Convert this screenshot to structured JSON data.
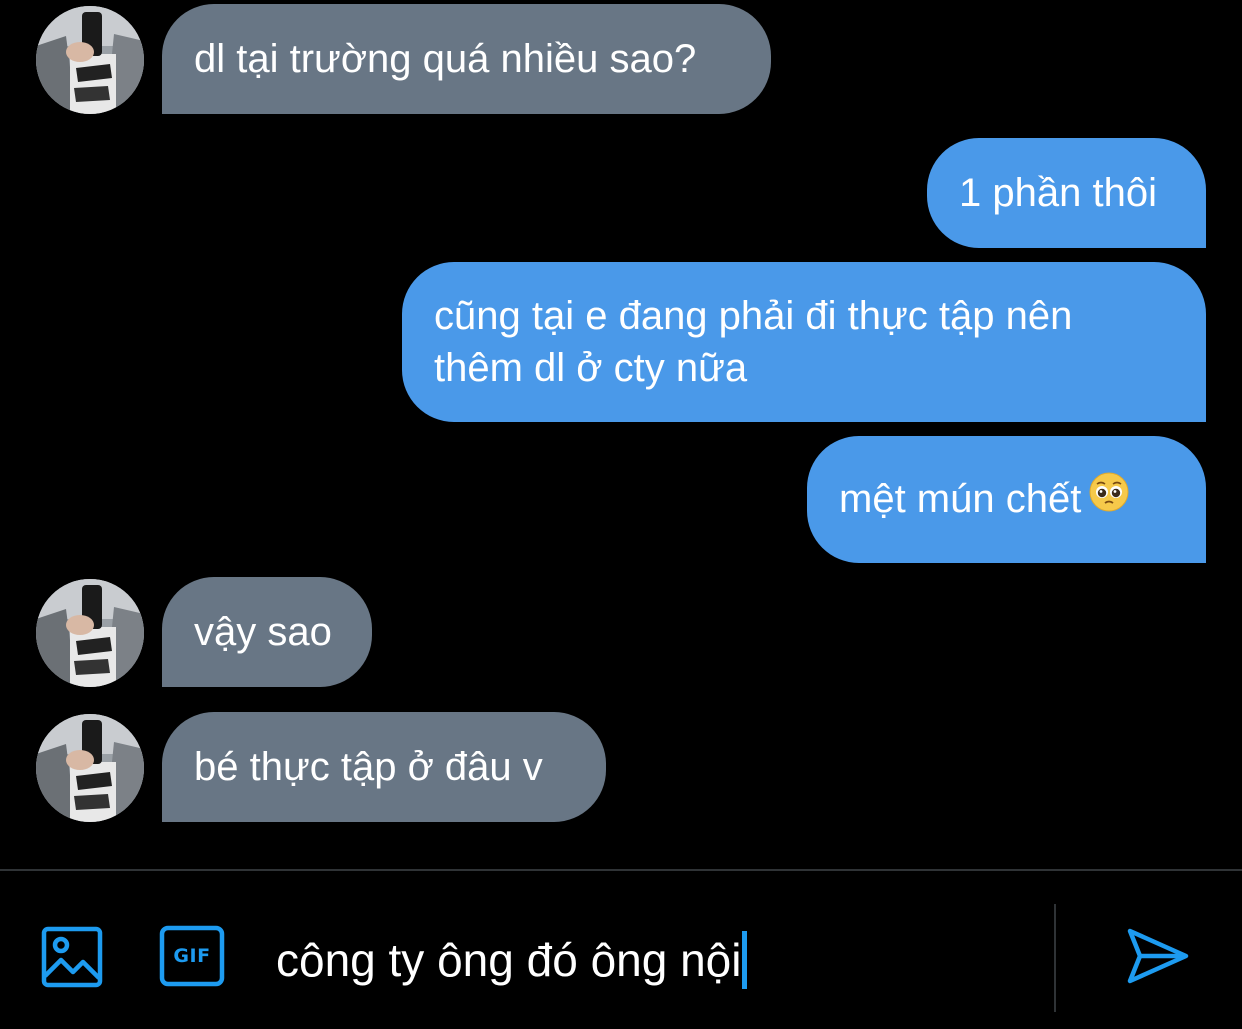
{
  "conversation": {
    "messages": [
      {
        "direction": "incoming",
        "text": "dl tại trường quá nhiều sao?"
      },
      {
        "direction": "outgoing",
        "text": "1 phần thôi"
      },
      {
        "direction": "outgoing",
        "lines": [
          "cũng tại e đang phải đi thực tập nên",
          "thêm dl ở cty nữa"
        ]
      },
      {
        "direction": "outgoing",
        "text": "mệt mún chết",
        "emoji": "pleading-face"
      },
      {
        "direction": "incoming",
        "text": "vậy sao"
      },
      {
        "direction": "incoming",
        "text": "bé thực tập ở đâu v"
      }
    ]
  },
  "composer": {
    "input_value": "công ty ông đó ông nội",
    "icons": {
      "media": "image-icon",
      "gif": "gif-icon",
      "send": "send-icon"
    },
    "gif_label": "GIF"
  },
  "colors": {
    "background": "#000000",
    "incoming_bubble": "#687685",
    "outgoing_bubble": "#4a99e9",
    "accent": "#1d9bf0",
    "divider": "#2f3336"
  }
}
